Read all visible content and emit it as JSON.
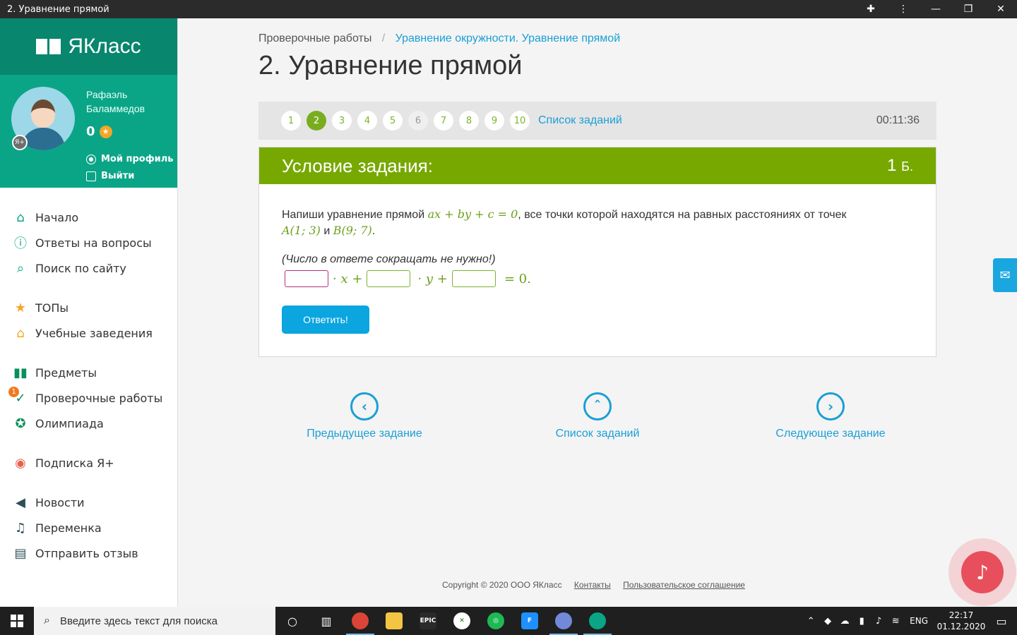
{
  "window": {
    "title": "2. Уравнение прямой"
  },
  "sidebar": {
    "logo": "ЯКласс",
    "user": {
      "name": "Рафаэль Баламмедов",
      "score": "0",
      "profile_label": "Мой профиль",
      "logout_label": "Выйти"
    },
    "items": [
      {
        "label": "Начало",
        "icon": "home-icon"
      },
      {
        "label": "Ответы на вопросы",
        "icon": "question-icon"
      },
      {
        "label": "Поиск по сайту",
        "icon": "search-icon"
      },
      {
        "label": "ТОПы",
        "icon": "star-icon"
      },
      {
        "label": "Учебные заведения",
        "icon": "institution-icon"
      },
      {
        "label": "Предметы",
        "icon": "books-icon"
      },
      {
        "label": "Проверочные работы",
        "icon": "check-icon",
        "badge": "1"
      },
      {
        "label": "Олимпиада",
        "icon": "medal-icon"
      },
      {
        "label": "Подписка Я+",
        "icon": "ya-plus-icon"
      },
      {
        "label": "Новости",
        "icon": "megaphone-icon"
      },
      {
        "label": "Переменка",
        "icon": "bell-icon"
      },
      {
        "label": "Отправить отзыв",
        "icon": "feedback-icon"
      }
    ]
  },
  "breadcrumb": {
    "parent": "Проверочные работы",
    "current": "Уравнение окружности. Уравнение прямой"
  },
  "page_title": "2. Уравнение прямой",
  "task_nav": {
    "numbers": [
      "1",
      "2",
      "3",
      "4",
      "5",
      "6",
      "7",
      "8",
      "9",
      "10"
    ],
    "active": "2",
    "list_label": "Список заданий",
    "timer": "00:11:36"
  },
  "task": {
    "header": "Условие задания:",
    "points": "1",
    "points_unit": "Б.",
    "text_before": "Напиши уравнение прямой ",
    "equation": "ax + by + c = 0",
    "text_middle": ", все точки которой находятся на равных расстояниях от точек",
    "point_a": "A(1; 3)",
    "and_word": " и ",
    "point_b": "B(9; 7)",
    "period": ".",
    "hint": "(Число в ответе сокращать не нужно!)",
    "answer": {
      "x_part": "· x +",
      "y_part": "· y +",
      "end_part": "= 0."
    },
    "submit_label": "Ответить!"
  },
  "bottom_nav": {
    "prev": "Предыдущее задание",
    "list": "Список заданий",
    "next": "Следующее задание"
  },
  "footer": {
    "copyright": "Copyright © 2020 ООО ЯКласс",
    "contacts": "Контакты",
    "agreement": "Пользовательское соглашение"
  },
  "taskbar": {
    "search_placeholder": "Введите здесь текст для поиска",
    "lang": "ENG",
    "time": "22:17",
    "date": "01.12.2020",
    "epic_label": "EPIC",
    "f_label": "F"
  },
  "colors": {
    "brand": "#08866e",
    "green": "#77a800",
    "link": "#1a9fd6",
    "button": "#0ba5e0"
  }
}
